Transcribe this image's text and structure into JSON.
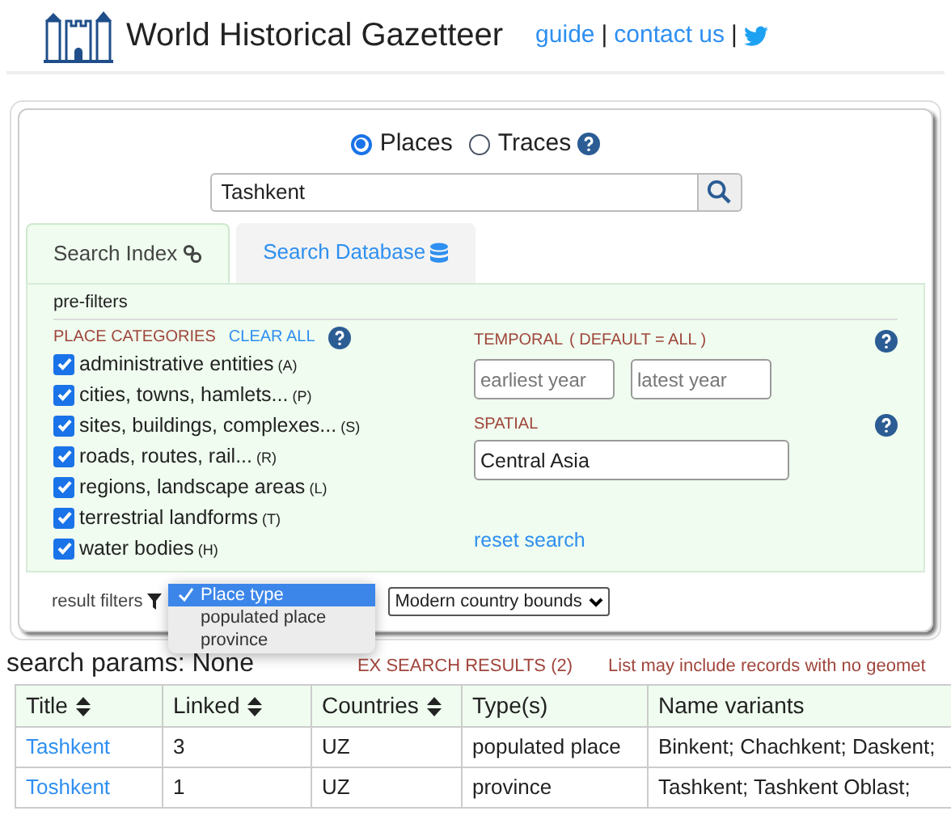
{
  "header": {
    "title": "World Historical Gazetteer",
    "links": [
      "guide",
      "contact us"
    ],
    "separators": [
      "|",
      "|"
    ]
  },
  "mode_options": [
    {
      "label": "Places",
      "selected": true
    },
    {
      "label": "Traces",
      "selected": false
    }
  ],
  "search": {
    "value": "Tashkent"
  },
  "tabs": [
    {
      "label": "Search Index",
      "selected": true
    },
    {
      "label": "Search Database",
      "selected": false
    }
  ],
  "prefilters": {
    "title": "pre-filters",
    "categories_label": "PLACE CATEGORIES",
    "clear_all": "CLEAR ALL",
    "categories": [
      {
        "label": "administrative entities",
        "code": "(A)",
        "checked": true
      },
      {
        "label": "cities, towns, hamlets...",
        "code": "(P)",
        "checked": true
      },
      {
        "label": "sites, buildings, complexes...",
        "code": "(S)",
        "checked": true
      },
      {
        "label": "roads, routes, rail...",
        "code": "(R)",
        "checked": true
      },
      {
        "label": "regions, landscape areas",
        "code": "(L)",
        "checked": true
      },
      {
        "label": "terrestrial landforms",
        "code": "(T)",
        "checked": true
      },
      {
        "label": "water bodies",
        "code": "(H)",
        "checked": true
      }
    ],
    "temporal_label": "TEMPORAL",
    "temporal_note": "( DEFAULT = ALL )",
    "earliest_placeholder": "earliest year",
    "latest_placeholder": "latest year",
    "spatial_label": "SPATIAL",
    "spatial_value": "Central Asia",
    "reset": "reset search"
  },
  "result_filters": {
    "label": "result filters",
    "type_menu": [
      {
        "label": "Place type",
        "selected": true
      },
      {
        "label": "populated place",
        "selected": false
      },
      {
        "label": "province",
        "selected": false
      }
    ],
    "bounds_select": "Modern country bounds"
  },
  "search_params": "search params: None",
  "results_heading": "EX SEARCH RESULTS (2)",
  "results_note": "List may include records with no geomet",
  "table": {
    "columns": [
      {
        "label": "Title",
        "sortable": true
      },
      {
        "label": "Linked",
        "sortable": true
      },
      {
        "label": "Countries",
        "sortable": true
      },
      {
        "label": "Type(s)",
        "sortable": false
      },
      {
        "label": "Name variants",
        "sortable": false
      }
    ],
    "rows": [
      [
        "Tashkent",
        "3",
        "UZ",
        "populated place",
        "Binkent; Chachkent; Daskent;"
      ],
      [
        "Toshkent",
        "1",
        "UZ",
        "province",
        "Tashkent; Tashkent Oblast;"
      ]
    ]
  }
}
